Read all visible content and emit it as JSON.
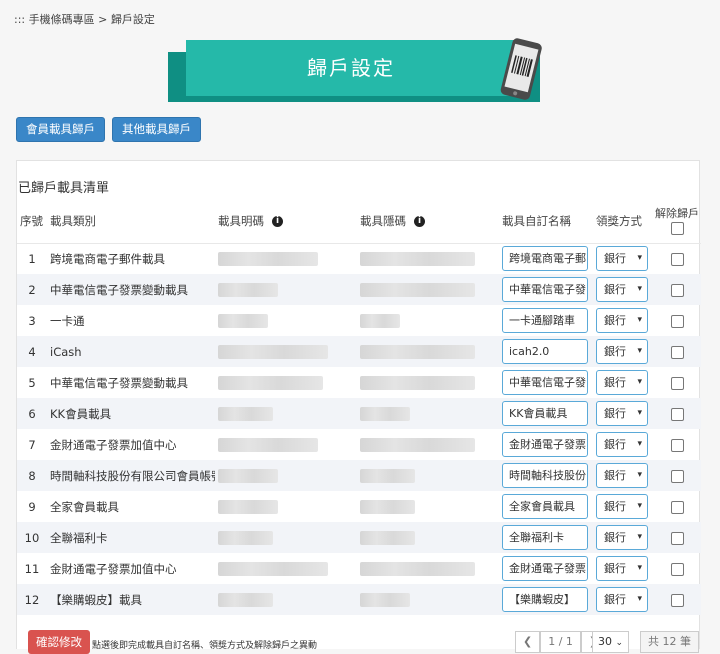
{
  "breadcrumb": {
    "prefix": ":::",
    "parent": "手機條碼專區",
    "sep": ">",
    "current": "歸戶設定"
  },
  "banner": {
    "title": "歸戶設定"
  },
  "tabs": [
    {
      "label": "會員載具歸戶"
    },
    {
      "label": "其他載具歸戶"
    }
  ],
  "panel": {
    "title": "已歸戶載具清單"
  },
  "columns": {
    "no": "序號",
    "type": "載具類別",
    "explicit": "載具明碼",
    "hidden": "載具隱碼",
    "custom_name": "載具自訂名稱",
    "award_method": "領獎方式",
    "unbind": "解除歸戶"
  },
  "rows": [
    {
      "no": "1",
      "type": "跨境電商電子郵件載具",
      "custom_name": "跨境電商電子郵",
      "award": "銀行"
    },
    {
      "no": "2",
      "type": "中華電信電子發票變動載具",
      "custom_name": "中華電信電子發",
      "award": "銀行"
    },
    {
      "no": "3",
      "type": "一卡通",
      "custom_name": "一卡通腳踏車",
      "award": "銀行"
    },
    {
      "no": "4",
      "type": "iCash",
      "custom_name": "icah2.0",
      "award": "銀行"
    },
    {
      "no": "5",
      "type": "中華電信電子發票變動載具",
      "custom_name": "中華電信電子發",
      "award": "銀行"
    },
    {
      "no": "6",
      "type": "KK會員載具",
      "custom_name": "KK會員載具",
      "award": "銀行"
    },
    {
      "no": "7",
      "type": "金財通電子發票加值中心",
      "custom_name": "金財通電子發票",
      "award": "銀行"
    },
    {
      "no": "8",
      "type": "時間軸科技股份有限公司會員帳號",
      "custom_name": "時間軸科技股份",
      "award": "銀行"
    },
    {
      "no": "9",
      "type": "全家會員載具",
      "custom_name": "全家會員載具",
      "award": "銀行"
    },
    {
      "no": "10",
      "type": "全聯福利卡",
      "custom_name": "全聯福利卡",
      "award": "銀行"
    },
    {
      "no": "11",
      "type": "金財通電子發票加值中心",
      "custom_name": "金財通電子發票",
      "award": "銀行"
    },
    {
      "no": "12",
      "type": "【樂購蝦皮】載具",
      "custom_name": "【樂購蝦皮】",
      "award": "銀行"
    }
  ],
  "footer": {
    "confirm_label": "確認修改",
    "hint": "點選後即完成載具自訂名稱、領獎方式及解除歸戶之異動",
    "page_indicator": "1 / 1",
    "page_size": "30",
    "total": "共 12 筆"
  },
  "colors": {
    "banner": "#25b9a9",
    "tab_button": "#3a87c8",
    "confirm_button": "#d9534f"
  }
}
